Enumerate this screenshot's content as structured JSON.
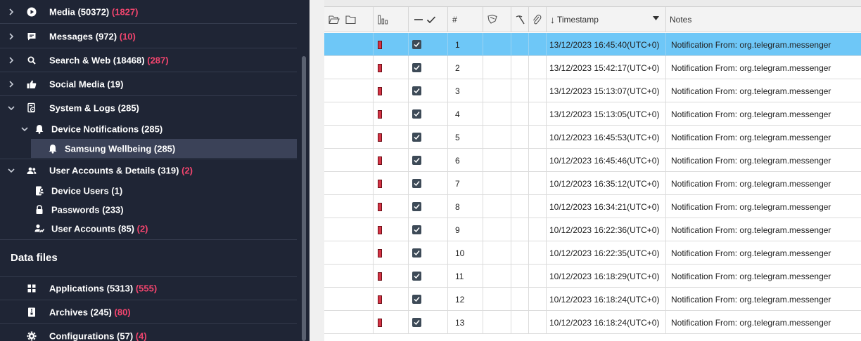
{
  "sidebar": {
    "items": [
      {
        "label": "Media (50372)",
        "badge": "(1827)",
        "icon": "play-circle-icon"
      },
      {
        "label": "Messages (972)",
        "badge": "(10)",
        "icon": "chat-bubble-icon"
      },
      {
        "label": "Search & Web (18468)",
        "badge": "(287)",
        "icon": "search-icon"
      },
      {
        "label": "Social Media (19)",
        "badge": "",
        "icon": "thumbs-up-icon"
      },
      {
        "label": "System & Logs (285)",
        "badge": "",
        "icon": "system-logs-icon"
      },
      {
        "label": "Device Notifications (285)",
        "badge": "",
        "icon": "bell-icon"
      },
      {
        "label": "Samsung Wellbeing (285)",
        "badge": "",
        "icon": "bell-icon"
      },
      {
        "label": "User Accounts & Details (319)",
        "badge": "(2)",
        "icon": "users-icon"
      },
      {
        "label": "Device Users (1)",
        "badge": "",
        "icon": "device-user-icon"
      },
      {
        "label": "Passwords (233)",
        "badge": "",
        "icon": "lock-icon"
      },
      {
        "label": "User Accounts (85)",
        "badge": "(2)",
        "icon": "user-account-icon"
      }
    ],
    "section_title": "Data files",
    "data_files": [
      {
        "label": "Applications (5313)",
        "badge": "(555)",
        "icon": "grid-icon"
      },
      {
        "label": "Archives (245)",
        "badge": "(80)",
        "icon": "archive-icon"
      },
      {
        "label": "Configurations (57)",
        "badge": "(4)",
        "icon": "gear-icon"
      }
    ],
    "colors": {
      "background": "#1f2535",
      "badge": "#f2456e",
      "selected": "#3b4258"
    }
  },
  "grid": {
    "headers": {
      "number": "#",
      "timestamp": "Timestamp",
      "notes": "Notes",
      "sort_indicator": "↓"
    },
    "colors": {
      "selected_row": "#6ec7f7",
      "tag": "#d63345",
      "checkbox": "#3d4a57"
    },
    "rows": [
      {
        "num": "1",
        "timestamp": "13/12/2023 16:45:40(UTC+0)",
        "notes": "Notification From: org.telegram.messenger",
        "selected": true
      },
      {
        "num": "2",
        "timestamp": "13/12/2023 15:42:17(UTC+0)",
        "notes": "Notification From: org.telegram.messenger",
        "selected": false
      },
      {
        "num": "3",
        "timestamp": "13/12/2023 15:13:07(UTC+0)",
        "notes": "Notification From: org.telegram.messenger",
        "selected": false
      },
      {
        "num": "4",
        "timestamp": "13/12/2023 15:13:05(UTC+0)",
        "notes": "Notification From: org.telegram.messenger",
        "selected": false
      },
      {
        "num": "5",
        "timestamp": "10/12/2023 16:45:53(UTC+0)",
        "notes": "Notification From: org.telegram.messenger",
        "selected": false
      },
      {
        "num": "6",
        "timestamp": "10/12/2023 16:45:46(UTC+0)",
        "notes": "Notification From: org.telegram.messenger",
        "selected": false
      },
      {
        "num": "7",
        "timestamp": "10/12/2023 16:35:12(UTC+0)",
        "notes": "Notification From: org.telegram.messenger",
        "selected": false
      },
      {
        "num": "8",
        "timestamp": "10/12/2023 16:34:21(UTC+0)",
        "notes": "Notification From: org.telegram.messenger",
        "selected": false
      },
      {
        "num": "9",
        "timestamp": "10/12/2023 16:22:36(UTC+0)",
        "notes": "Notification From: org.telegram.messenger",
        "selected": false
      },
      {
        "num": "10",
        "timestamp": "10/12/2023 16:22:35(UTC+0)",
        "notes": "Notification From: org.telegram.messenger",
        "selected": false
      },
      {
        "num": "11",
        "timestamp": "10/12/2023 16:18:29(UTC+0)",
        "notes": "Notification From: org.telegram.messenger",
        "selected": false
      },
      {
        "num": "12",
        "timestamp": "10/12/2023 16:18:24(UTC+0)",
        "notes": "Notification From: org.telegram.messenger",
        "selected": false
      },
      {
        "num": "13",
        "timestamp": "10/12/2023 16:18:24(UTC+0)",
        "notes": "Notification From: org.telegram.messenger",
        "selected": false
      }
    ]
  }
}
